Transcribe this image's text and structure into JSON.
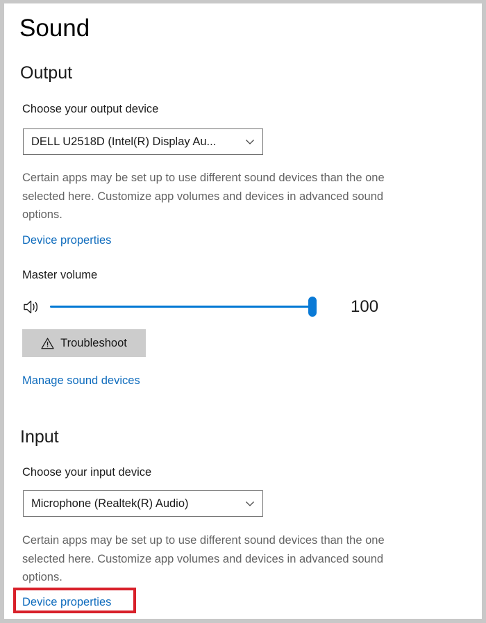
{
  "window": {
    "title": "Sound",
    "border_color": "#c8c8c8"
  },
  "theme": {
    "link_color": "#0f6cbd",
    "accent_color": "#0078d4",
    "body_text_color": "#1b1b1b",
    "muted_text_color": "#636363",
    "button_bg_color": "#cccccc",
    "annotation_color": "#d8202a"
  },
  "output": {
    "heading": "Output",
    "device_label": "Choose your output device",
    "device_value": "DELL U2518D (Intel(R) Display Au...",
    "chevron_icon": "chevron-down-icon",
    "description": "Certain apps may be set up to use different sound devices than the one selected here. Customize app volumes and devices in advanced sound options.",
    "device_properties_link": "Device properties",
    "volume_label": "Master volume",
    "volume_icon": "speaker-volume-icon",
    "volume_value": "100",
    "volume_min": 0,
    "volume_max": 100,
    "troubleshoot_label": "Troubleshoot",
    "troubleshoot_icon": "warning-triangle-icon",
    "manage_devices_link": "Manage sound devices"
  },
  "input": {
    "heading": "Input",
    "device_label": "Choose your input device",
    "device_value": "Microphone (Realtek(R) Audio)",
    "chevron_icon": "chevron-down-icon",
    "description": "Certain apps may be set up to use different sound devices than the one selected here. Customize app volumes and devices in advanced sound options.",
    "device_properties_link": "Device properties"
  },
  "annotation": {
    "target": "input-device-properties-link",
    "color": "#d8202a"
  }
}
